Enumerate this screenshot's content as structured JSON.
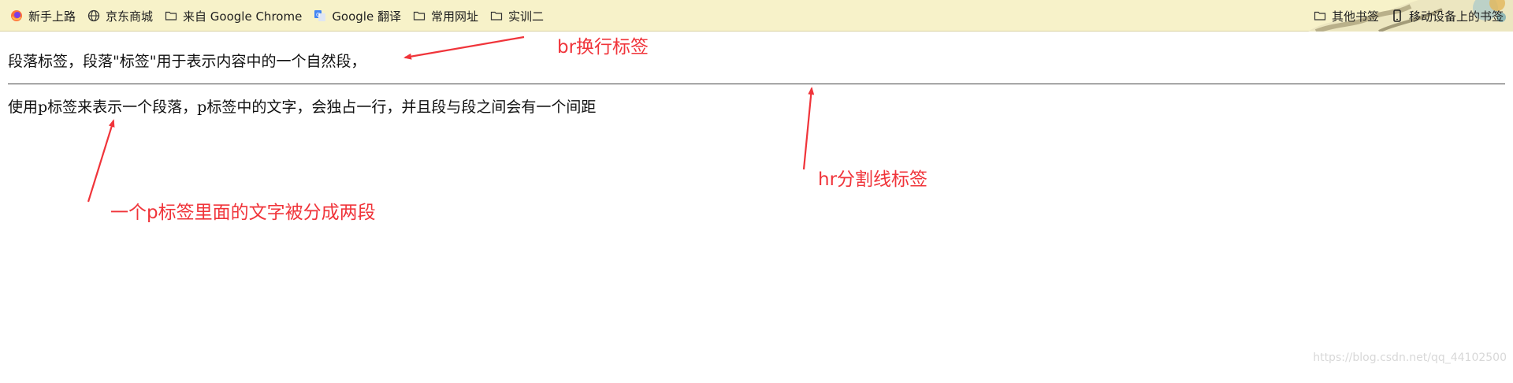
{
  "bookmarks_bar": {
    "left_items": [
      {
        "label": "新手上路",
        "icon": "firefox-icon"
      },
      {
        "label": "京东商城",
        "icon": "globe-icon"
      },
      {
        "label": "来自 Google Chrome",
        "icon": "folder-icon"
      },
      {
        "label": "Google 翻译",
        "icon": "google-translate-icon"
      },
      {
        "label": "常用网址",
        "icon": "folder-icon"
      },
      {
        "label": "实训二",
        "icon": "folder-icon"
      }
    ],
    "right_items": [
      {
        "label": "其他书签",
        "icon": "folder-icon"
      },
      {
        "label": "移动设备上的书签",
        "icon": "mobile-icon"
      }
    ]
  },
  "page": {
    "paragraph1": "段落标签，段落\"标签\"用于表示内容中的一个自然段，",
    "paragraph2": "使用p标签来表示一个段落，p标签中的文字，会独占一行，并且段与段之间会有一个间距"
  },
  "annotations": {
    "br": "br换行标签",
    "hr": "hr分割线标签",
    "p": "一个p标签里面的文字被分成两段"
  },
  "watermark": "https://blog.csdn.net/qq_44102500",
  "colors": {
    "bookmarks_bg": "#f7f2c9",
    "annotation": "#f0343a"
  }
}
